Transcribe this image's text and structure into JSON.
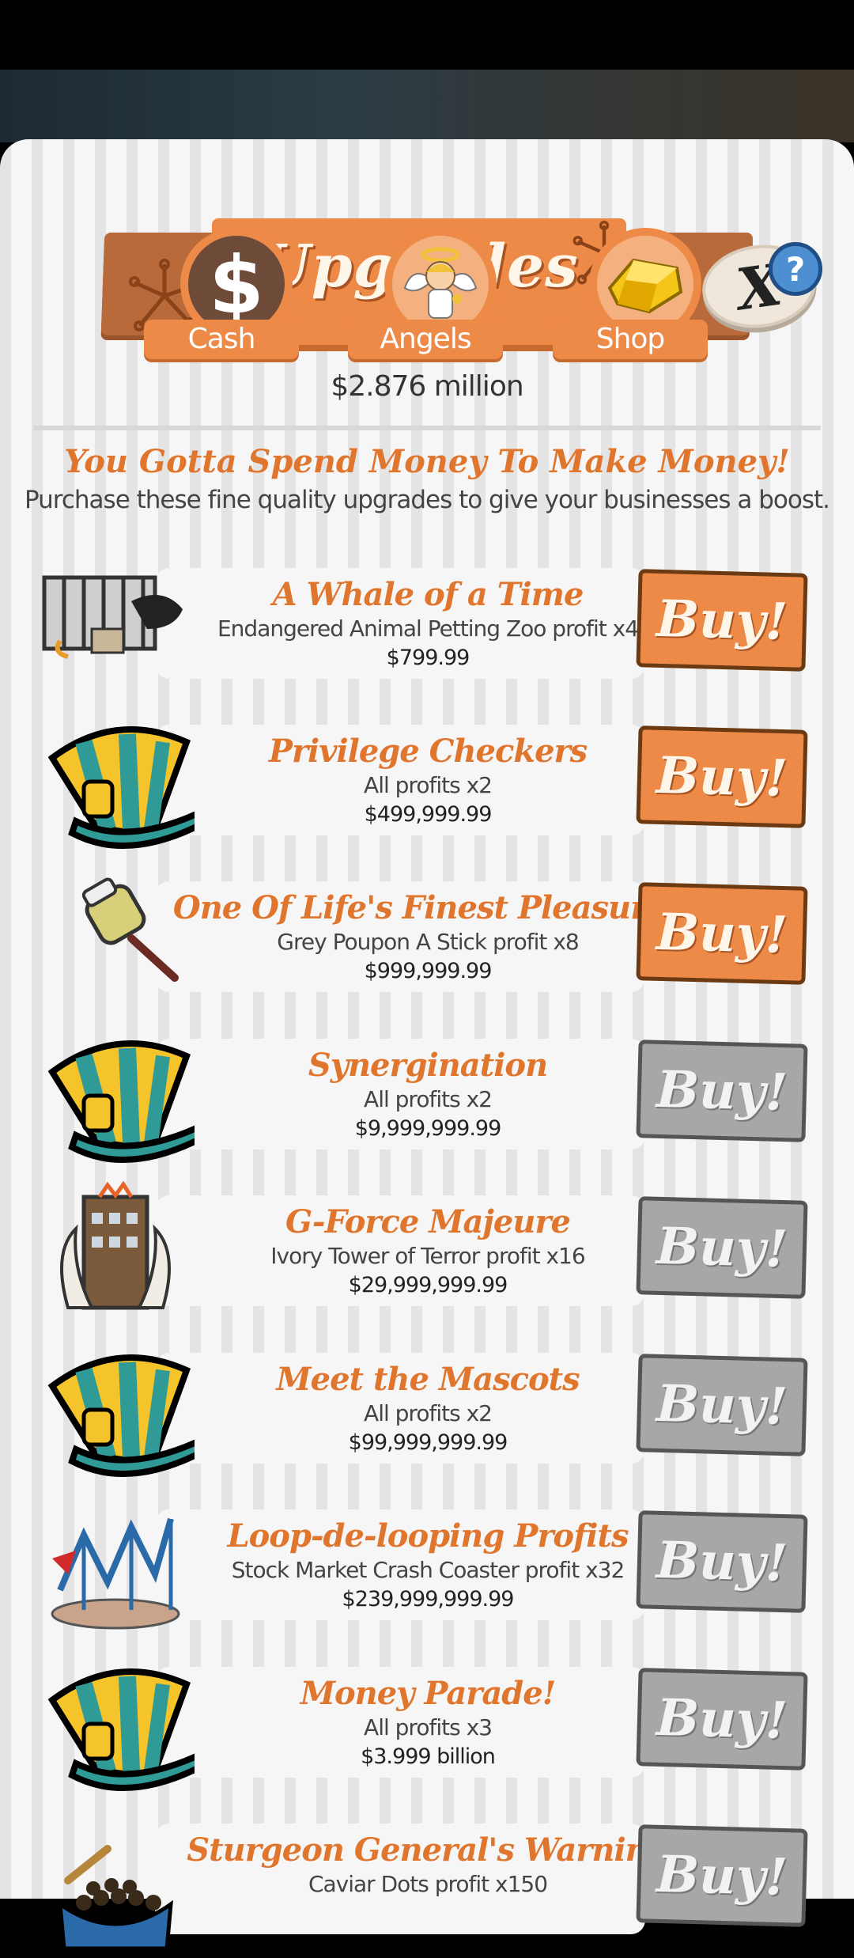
{
  "header": {
    "title": "Upgrades",
    "close_label": "X",
    "help_label": "?"
  },
  "tabs": [
    {
      "label": "Cash",
      "icon": "dollar-icon"
    },
    {
      "label": "Angels",
      "icon": "angel-icon"
    },
    {
      "label": "Shop",
      "icon": "gold-icon"
    }
  ],
  "balance": "$2.876 million",
  "intro": {
    "headline": "You Gotta Spend Money To Make Money!",
    "subline": "Purchase these fine quality upgrades to give your businesses a boost."
  },
  "upgrades": [
    {
      "name": "A Whale of a Time",
      "desc": "Endangered Animal Petting Zoo profit x4",
      "price": "$799.99",
      "buy": "Buy!",
      "affordable": true,
      "icon": "zoo-icon"
    },
    {
      "name": "Privilege Checkers",
      "desc": "All profits x2",
      "price": "$499,999.99",
      "buy": "Buy!",
      "affordable": true,
      "icon": "top-hat-icon"
    },
    {
      "name": "One Of Life's Finest Pleasures",
      "desc": "Grey Poupon A Stick profit x8",
      "price": "$999,999.99",
      "buy": "Buy!",
      "affordable": true,
      "icon": "mustard-stick-icon"
    },
    {
      "name": "Synergination",
      "desc": "All profits x2",
      "price": "$9,999,999.99",
      "buy": "Buy!",
      "affordable": false,
      "icon": "top-hat-icon"
    },
    {
      "name": "G-Force Majeure",
      "desc": "Ivory Tower of Terror profit x16",
      "price": "$29,999,999.99",
      "buy": "Buy!",
      "affordable": false,
      "icon": "ivory-tower-icon"
    },
    {
      "name": "Meet the Mascots",
      "desc": "All profits x2",
      "price": "$99,999,999.99",
      "buy": "Buy!",
      "affordable": false,
      "icon": "top-hat-icon"
    },
    {
      "name": "Loop-de-looping Profits",
      "desc": "Stock Market Crash Coaster profit x32",
      "price": "$239,999,999.99",
      "buy": "Buy!",
      "affordable": false,
      "icon": "coaster-icon"
    },
    {
      "name": "Money Parade!",
      "desc": "All profits x3",
      "price": "$3.999 billion",
      "buy": "Buy!",
      "affordable": false,
      "icon": "top-hat-icon"
    },
    {
      "name": "Sturgeon General's Warning",
      "desc": "Caviar Dots profit x150",
      "price": "",
      "buy": "Buy!",
      "affordable": false,
      "icon": "caviar-icon"
    }
  ],
  "colors": {
    "accent": "#ee8a47",
    "title_text": "#e0762d",
    "disabled": "#a7a7a7",
    "help_blue": "#4d8fd1"
  }
}
